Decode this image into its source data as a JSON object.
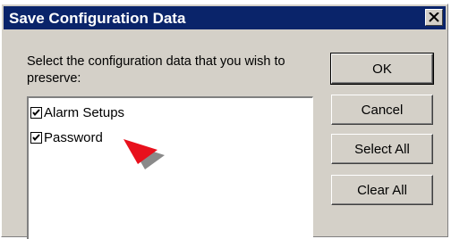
{
  "dialog": {
    "title": "Save Configuration Data",
    "prompt": "Select the configuration data that you wish to preserve:",
    "items": [
      {
        "label": "Alarm Setups",
        "checked": true
      },
      {
        "label": "Password",
        "checked": true
      }
    ],
    "buttons": {
      "ok": "OK",
      "cancel": "Cancel",
      "select_all": "Select All",
      "clear_all": "Clear All"
    }
  },
  "icons": {
    "close": "close-icon",
    "check": "checkmark-icon",
    "pointer": "pointer-arrow-icon"
  },
  "colors": {
    "titlebar": "#0a246a",
    "face": "#d4d0c8",
    "pointer": "#e8101c"
  }
}
